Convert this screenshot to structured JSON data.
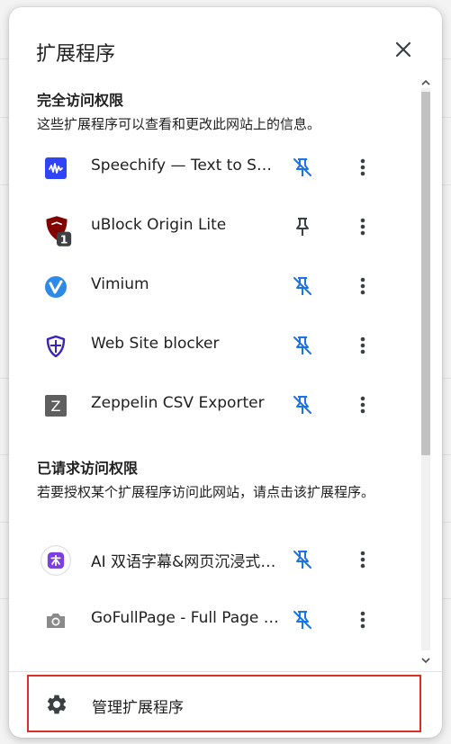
{
  "panel": {
    "title": "扩展程序",
    "close_icon": "close-icon"
  },
  "sections": [
    {
      "title": "完全访问权限",
      "description": "这些扩展程序可以查看和更改此网站上的信息。",
      "items": [
        {
          "name": "Speechify — Text to Speech",
          "icon": "speechify-icon",
          "pinned": false
        },
        {
          "name": "uBlock Origin Lite",
          "icon": "ublock-shield-icon",
          "badge": "1",
          "pinned": true
        },
        {
          "name": "Vimium",
          "icon": "vimium-icon",
          "pinned": false
        },
        {
          "name": "Web Site blocker",
          "icon": "website-blocker-shield-icon",
          "pinned": false
        },
        {
          "name": "Zeppelin CSV Exporter",
          "icon": "zeppelin-z-icon",
          "icon_letter": "Z",
          "pinned": false
        }
      ]
    },
    {
      "title": "已请求访问权限",
      "description": "若要授权某个扩展程序访问此网站，请点击该扩展程序。",
      "items": [
        {
          "name": "AI 双语字幕&网页沉浸式翻译",
          "icon": "ai-translate-icon",
          "pinned": false
        },
        {
          "name": "GoFullPage - Full Page Screen Capture",
          "icon": "camera-icon",
          "pinned": false
        }
      ]
    }
  ],
  "footer": {
    "manage_label": "管理扩展程序",
    "manage_icon": "gear-icon"
  },
  "colors": {
    "accent_blue": "#1a73e8",
    "highlight_red": "#d93025",
    "text": "#1f1f1f"
  }
}
